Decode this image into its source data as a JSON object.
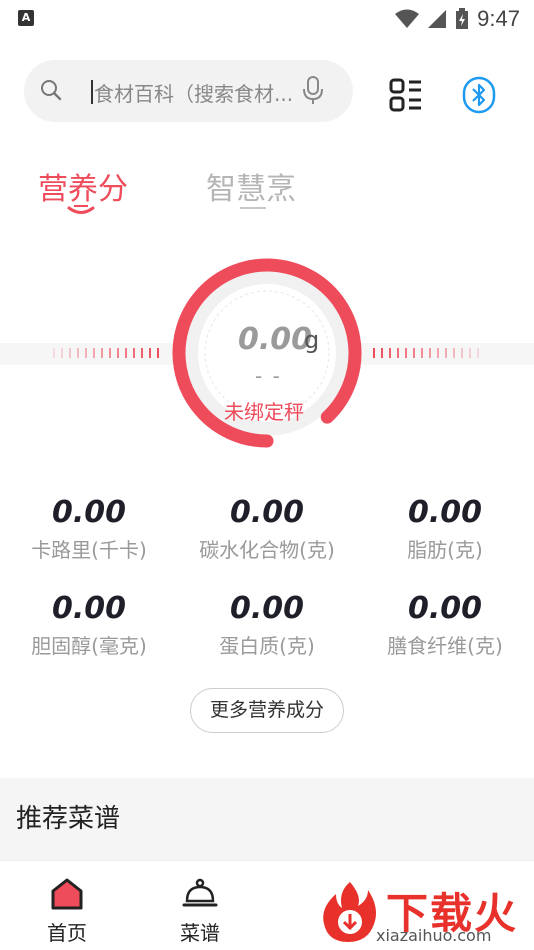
{
  "status_bar": {
    "left_badge": "A",
    "time": "9:47"
  },
  "search": {
    "placeholder": "食材百科（搜索食材...",
    "icons": [
      "search-icon",
      "mic-icon"
    ]
  },
  "header_icons": [
    "scan-icon",
    "bluetooth-icon"
  ],
  "tabs": [
    {
      "label": "营养分析",
      "visible_text": "营养分",
      "active": true
    },
    {
      "label": "智慧烹饪",
      "visible_text": "智慧烹",
      "active": false
    }
  ],
  "scale": {
    "value": "0.00",
    "unit": "g",
    "sub": "- -",
    "status": "未绑定秤",
    "accent_color": "#ee4b5b",
    "ring_fill_fraction": 0.88
  },
  "nutrients": [
    {
      "value": "0.00",
      "label": "卡路里(千卡)"
    },
    {
      "value": "0.00",
      "label": "碳水化合物(克)"
    },
    {
      "value": "0.00",
      "label": "脂肪(克)"
    },
    {
      "value": "0.00",
      "label": "胆固醇(毫克)"
    },
    {
      "value": "0.00",
      "label": "蛋白质(克)"
    },
    {
      "value": "0.00",
      "label": "膳食纤维(克)"
    }
  ],
  "more_button": "更多营养成分",
  "recommend_title": "推荐菜谱",
  "bottom_nav": [
    {
      "label": "首页",
      "icon": "home-icon",
      "active": true
    },
    {
      "label": "菜谱",
      "icon": "cloche-icon",
      "active": false
    }
  ],
  "watermark": {
    "text": "下载火",
    "sub": "xiazaihuo.com"
  }
}
